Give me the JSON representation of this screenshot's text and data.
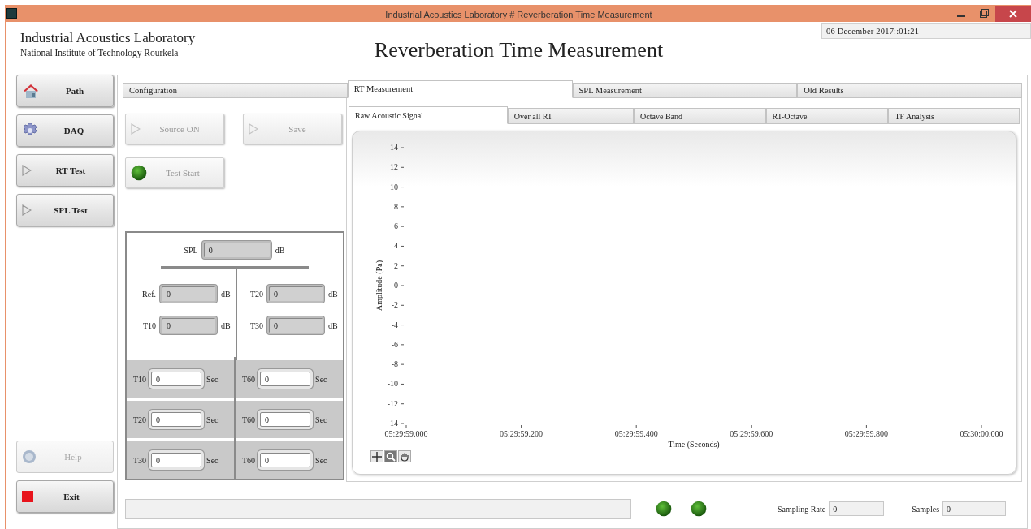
{
  "window": {
    "title": "Industrial Acoustics Laboratory # Reverberation Time Measurement"
  },
  "header": {
    "lab_name": "Industrial Acoustics Laboratory",
    "institute": "National Institute of Technology Rourkela",
    "page_title": "Reverberation Time Measurement",
    "datetime": "06 December 2017::01:21"
  },
  "sidebar": {
    "top_buttons": [
      {
        "label": "Path",
        "kind": "home",
        "disabled": false
      },
      {
        "label": "DAQ",
        "kind": "gear",
        "disabled": false
      },
      {
        "label": "RT Test",
        "kind": "play",
        "disabled": false
      },
      {
        "label": "SPL Test",
        "kind": "play",
        "disabled": false
      }
    ],
    "bottom_buttons": [
      {
        "label": "Help",
        "kind": "help",
        "disabled": true
      },
      {
        "label": "Exit",
        "kind": "stop",
        "disabled": false
      }
    ]
  },
  "tabs": [
    {
      "label": "Configuration",
      "selected": false
    },
    {
      "label": "RT Measurement",
      "selected": true
    },
    {
      "label": "SPL Measurement",
      "selected": false
    },
    {
      "label": "Old Results",
      "selected": false
    }
  ],
  "controls": [
    {
      "label": "Source ON",
      "kind": "play",
      "disabled": true
    },
    {
      "label": "Save",
      "kind": "play",
      "disabled": true
    },
    {
      "label": "Test Start",
      "kind": "led",
      "disabled": true,
      "on": true
    }
  ],
  "results": {
    "spl": {
      "label": "SPL",
      "value": "0",
      "unit": "dB"
    },
    "levels": [
      {
        "label": "Ref.",
        "value": "0",
        "unit": "dB"
      },
      {
        "label": "T20",
        "value": "0",
        "unit": "dB"
      },
      {
        "label": "T10",
        "value": "0",
        "unit": "dB"
      },
      {
        "label": "T30",
        "value": "0",
        "unit": "dB"
      }
    ],
    "times": [
      {
        "label": "T10",
        "value": "0",
        "unit": "Sec"
      },
      {
        "label": "T60",
        "value": "0",
        "unit": "Sec"
      },
      {
        "label": "T20",
        "value": "0",
        "unit": "Sec"
      },
      {
        "label": "T60",
        "value": "0",
        "unit": "Sec"
      },
      {
        "label": "T30",
        "value": "0",
        "unit": "Sec"
      },
      {
        "label": "T60",
        "value": "0",
        "unit": "Sec"
      }
    ]
  },
  "sub_tabs": [
    {
      "label": "Raw Acoustic Signal",
      "selected": true
    },
    {
      "label": "Over all RT",
      "selected": false
    },
    {
      "label": "Octave Band",
      "selected": false
    },
    {
      "label": "RT-Octave",
      "selected": false
    },
    {
      "label": "TF Analysis",
      "selected": false
    }
  ],
  "plot": {
    "chart_data": {
      "type": "line",
      "xlabel": "Time (Seconds)",
      "ylabel": "Amplitude (Pa)",
      "ylim": [
        -14,
        14
      ],
      "categories": [
        "05:29:59.000",
        "05:29:59.200",
        "05:29:59.400",
        "05:29:59.600",
        "05:29:59.800",
        "05:30:00.000"
      ],
      "yticks": [
        14,
        12,
        10,
        8,
        6,
        4,
        2,
        0,
        -2,
        -4,
        -6,
        -8,
        -10,
        -12,
        -14
      ]
    },
    "tools": [
      {
        "kind": "cursor",
        "selected": false
      },
      {
        "kind": "zoom",
        "selected": true
      },
      {
        "kind": "pan",
        "selected": false
      }
    ]
  },
  "status": {
    "indicators": [
      {
        "on": true
      },
      {
        "on": true
      }
    ],
    "fields": [
      {
        "label": "Sampling Rate",
        "value": "0"
      },
      {
        "label": "Samples",
        "value": "0"
      }
    ]
  }
}
